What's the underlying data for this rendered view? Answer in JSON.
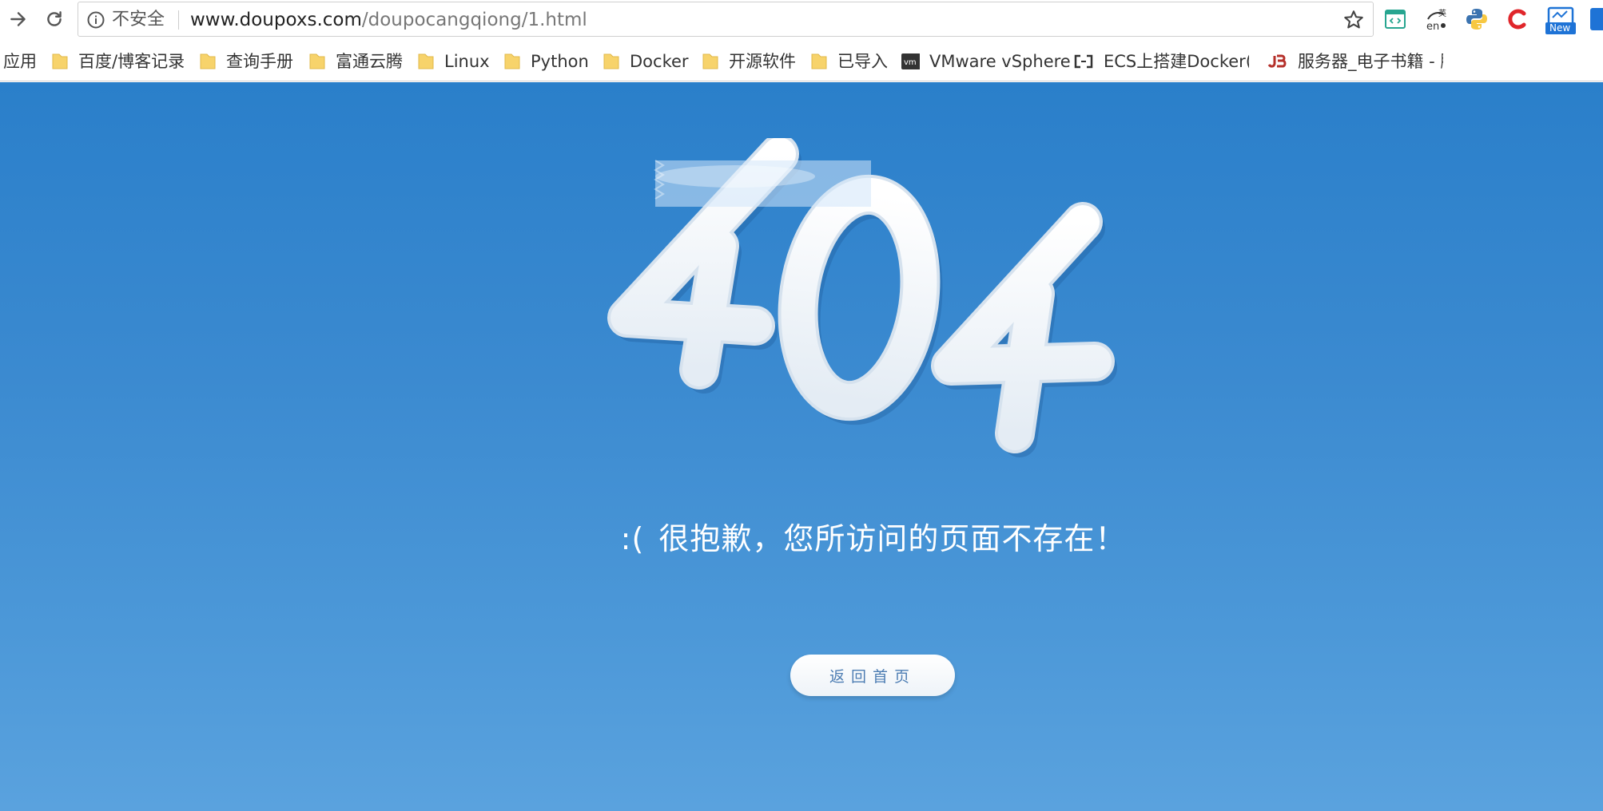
{
  "browser": {
    "security_label": "不安全",
    "url_host": "www.doupoxs.com",
    "url_path": "/doupocangqiong/1.html",
    "extensions": [
      "code-viewer-icon",
      "translate-en-icon",
      "python-icon",
      "c-red-icon",
      "new-badge-icon"
    ],
    "extension_new_badge": "New"
  },
  "bookmarks": {
    "items": [
      {
        "label": "应用",
        "icon": "apps-icon"
      },
      {
        "label": "百度/博客记录",
        "icon": "folder-icon"
      },
      {
        "label": "查询手册",
        "icon": "folder-icon"
      },
      {
        "label": "富通云腾",
        "icon": "folder-icon"
      },
      {
        "label": "Linux",
        "icon": "folder-icon"
      },
      {
        "label": "Python",
        "icon": "folder-icon"
      },
      {
        "label": "Docker",
        "icon": "folder-icon"
      },
      {
        "label": "开源软件",
        "icon": "folder-icon"
      },
      {
        "label": "已导入",
        "icon": "folder-icon"
      },
      {
        "label": "VMware vSphere",
        "icon": "vmware-icon"
      },
      {
        "label": "ECS上搭建Docker(C",
        "icon": "aliyun-icon"
      },
      {
        "label": "服务器_电子书籍 - 脚",
        "icon": "jb51-icon"
      }
    ]
  },
  "page": {
    "error_code": "404",
    "face": ":(",
    "message": "很抱歉，您所访问的页面不存在！",
    "home_button": "返回首页",
    "colors": {
      "background_top": "#2a7fca",
      "background_bottom": "#5aa2de",
      "button_text": "#4d7db3"
    }
  }
}
